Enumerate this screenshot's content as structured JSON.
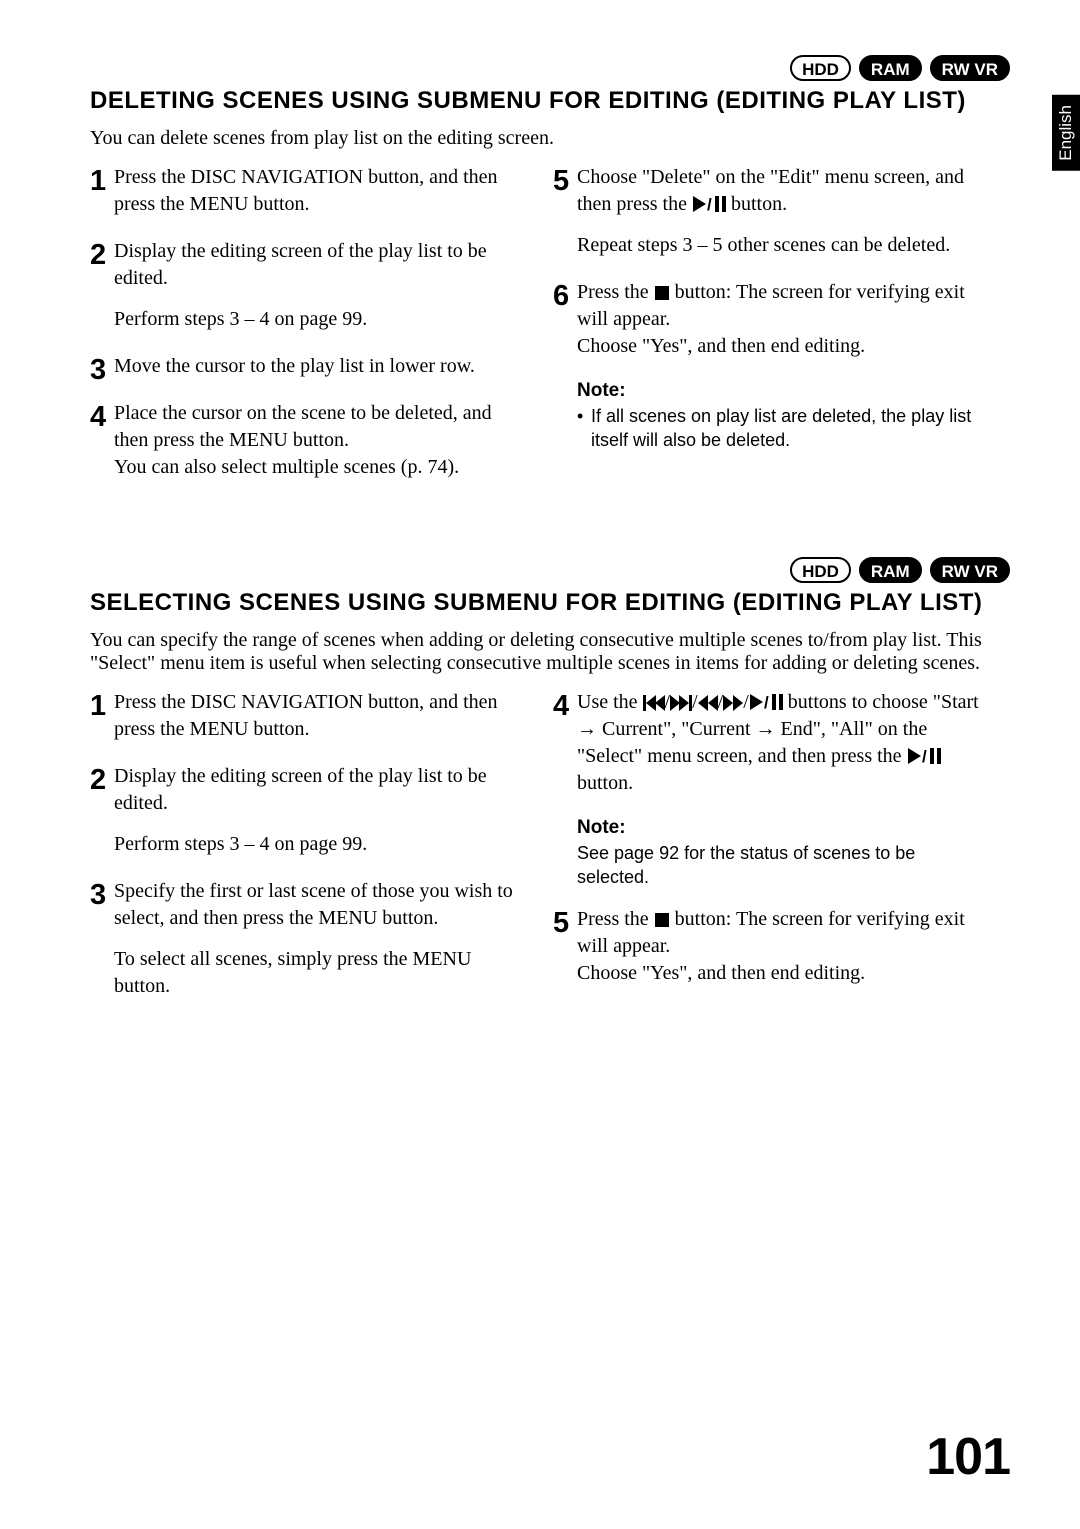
{
  "lang_tab": "English",
  "badges": {
    "hdd": "HDD",
    "ram": "RAM",
    "rwvr": "RW VR"
  },
  "section1": {
    "title": "DELETING SCENES USING SUBMENU FOR EDITING (EDITING PLAY LIST)",
    "intro": "You can delete scenes from play list on the editing screen.",
    "left": {
      "s1": "Press the DISC NAVIGATION button, and then press the MENU button.",
      "s2": "Display the editing screen of the play list to be edited.",
      "s2b": "Perform steps 3 – 4 on page 99.",
      "s3": "Move the cursor to the play list in lower row.",
      "s4a": "Place the cursor on the scene to be deleted, and then press the MENU button.",
      "s4b": "You can also select multiple scenes (p. 74)."
    },
    "right": {
      "s5a": "Choose \"Delete\" on the \"Edit\" menu screen, and then press the",
      "s5b": "button.",
      "s5c": "Repeat steps 3 – 5 other scenes can be deleted.",
      "s6a": "Press the",
      "s6b": "button: The screen for verifying exit will appear.",
      "s6c": "Choose \"Yes\", and then end editing.",
      "note_head": "Note:",
      "note_body": "If all scenes on play list are deleted, the play list itself will also be deleted."
    }
  },
  "section2": {
    "title": "SELECTING SCENES USING SUBMENU FOR EDITING (EDITING PLAY LIST)",
    "intro": "You can specify the range of scenes when adding or deleting consecutive multiple scenes to/from play list. This \"Select\" menu item is useful when selecting consecutive multiple scenes in items for adding or deleting scenes.",
    "left": {
      "s1": "Press the DISC NAVIGATION button, and then press the MENU button.",
      "s2": "Display the editing screen of the play list to be edited.",
      "s2b": "Perform steps 3 – 4 on page 99.",
      "s3a": "Specify the first or last scene of those you wish to select, and then press the MENU button.",
      "s3b": "To select all scenes, simply press the MENU button."
    },
    "right": {
      "s4a": "Use the",
      "s4b": "buttons to choose \"Start → Current\", \"Current → End\", \"All\" on the \"Select\" menu screen, and then press the",
      "s4c": "button.",
      "note_head": "Note:",
      "note_body": "See page 92 for the status of scenes to be selected.",
      "s5a": "Press the",
      "s5b": "button: The screen for verifying exit will appear.",
      "s5c": "Choose \"Yes\", and then end editing."
    }
  },
  "page_number": "101"
}
